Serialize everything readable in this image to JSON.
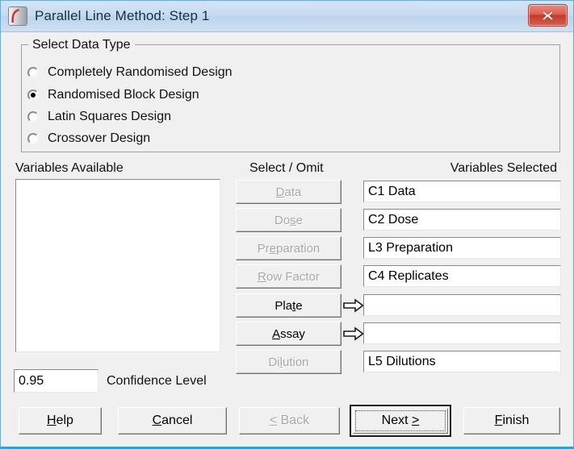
{
  "window": {
    "title": "Parallel Line Method: Step 1",
    "app_icon": "document-swoosh-icon",
    "close_icon": "close-icon",
    "accent_color": "#29a3d4",
    "titlebar_color": "#c8dcf0",
    "dialog_bg": "#f0f0f0",
    "close_button_color": "#c03a2c"
  },
  "group": {
    "legend": "Select Data Type",
    "options": [
      {
        "label": "Completely Randomised Design",
        "checked": false
      },
      {
        "label": "Randomised Block Design",
        "checked": true
      },
      {
        "label": "Latin Squares Design",
        "checked": false
      },
      {
        "label": "Crossover Design",
        "checked": false
      }
    ]
  },
  "headers": {
    "available": "Variables Available",
    "select_omit": "Select / Omit",
    "selected": "Variables Selected"
  },
  "available_list": {
    "items": []
  },
  "confidence": {
    "value": "0.95",
    "label": "Confidence Level"
  },
  "select_buttons": [
    {
      "label": "Data",
      "accel": "D",
      "enabled": false,
      "arrow": false
    },
    {
      "label": "Dose",
      "accel": "s",
      "enabled": false,
      "arrow": false
    },
    {
      "label": "Preparation",
      "accel": "e",
      "enabled": false,
      "arrow": false
    },
    {
      "label": "Row Factor",
      "accel": "R",
      "enabled": false,
      "arrow": false
    },
    {
      "label": "Plate",
      "accel": "t",
      "enabled": true,
      "arrow": true
    },
    {
      "label": "Assay",
      "accel": "A",
      "enabled": true,
      "arrow": true
    },
    {
      "label": "Dilution",
      "accel": "l",
      "enabled": false,
      "arrow": false
    }
  ],
  "selected_fields": [
    {
      "value": "C1 Data"
    },
    {
      "value": "C2 Dose"
    },
    {
      "value": "L3 Preparation"
    },
    {
      "value": "C4 Replicates"
    },
    {
      "value": ""
    },
    {
      "value": ""
    },
    {
      "value": "L5 Dilutions"
    }
  ],
  "footer": {
    "help": {
      "label": "Help",
      "accel": "H",
      "enabled": true,
      "default": false
    },
    "cancel": {
      "label": "Cancel",
      "accel": "C",
      "enabled": true,
      "default": false
    },
    "back": {
      "label": "< Back",
      "accel": "<",
      "enabled": false,
      "default": false
    },
    "next": {
      "label": "Next >",
      "accel": ">",
      "enabled": true,
      "default": true
    },
    "finish": {
      "label": "Finish",
      "accel": "F",
      "enabled": true,
      "default": false
    }
  }
}
